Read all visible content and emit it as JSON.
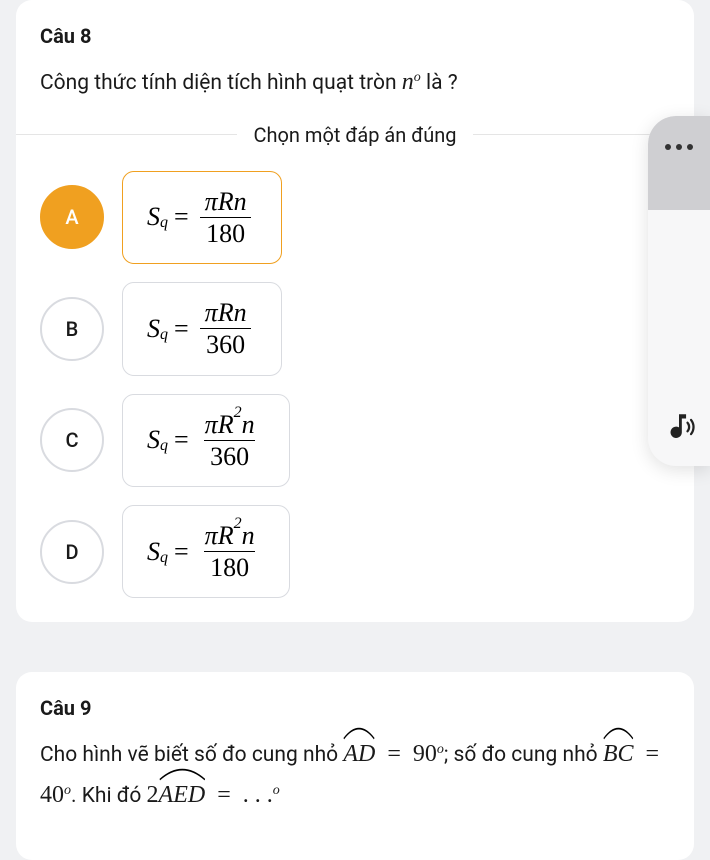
{
  "q8": {
    "title": "Câu 8",
    "prompt_before": "Công thức tính diện tích hình quạt tròn ",
    "prompt_var": "n",
    "prompt_exp": "o",
    "prompt_after": " là ?",
    "divider": "Chọn một đáp án đúng",
    "options": [
      {
        "label": "A",
        "selected": true,
        "lhs": "S",
        "sub": "q",
        "num": "πRn",
        "den": "180"
      },
      {
        "label": "B",
        "selected": false,
        "lhs": "S",
        "sub": "q",
        "num": "πRn",
        "den": "360"
      },
      {
        "label": "C",
        "selected": false,
        "lhs": "S",
        "sub": "q",
        "num": "πR²n",
        "den": "360"
      },
      {
        "label": "D",
        "selected": false,
        "lhs": "S",
        "sub": "q",
        "num": "πR²n",
        "den": "180"
      }
    ]
  },
  "q9": {
    "title": "Câu 9",
    "t1": "Cho hình vẽ biết số đo cung nhỏ ",
    "arc1": "AD",
    "eq1": " = ",
    "v1": "90",
    "deg": "o",
    "t2": "; số đo cung nhỏ ",
    "arc2": "BC",
    "eq2": " = ",
    "v2": "40",
    "t3": ". Khi đó ",
    "coef": "2",
    "arc3": "AED",
    "eq3": " = ",
    "dots": ". . .",
    "deg2": "o"
  }
}
